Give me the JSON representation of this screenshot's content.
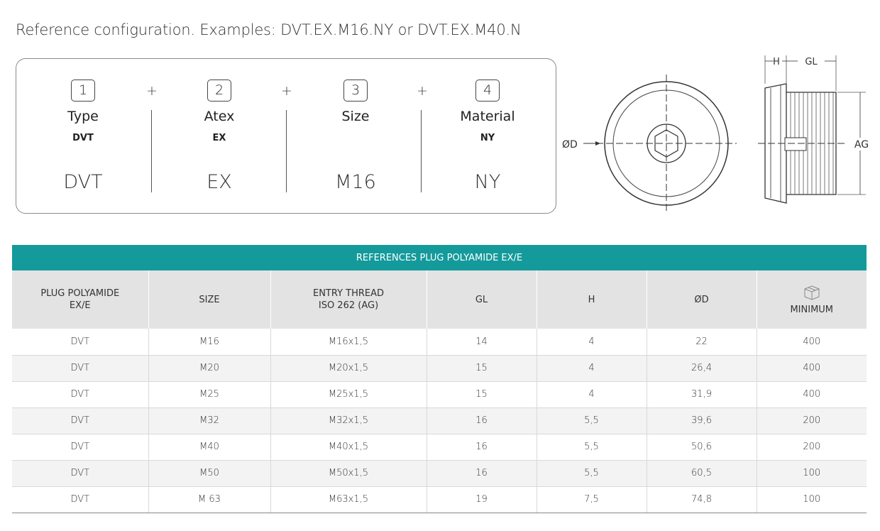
{
  "headline": "Reference configuration. Examples: DVT.EX.M16.NY or DVT.EX.M40.N",
  "configurator": {
    "plus_sign": "+",
    "columns": [
      {
        "number": "1",
        "title": "Type",
        "code": "DVT",
        "value": "DVT"
      },
      {
        "number": "2",
        "title": "Atex",
        "code": "EX",
        "value": "EX"
      },
      {
        "number": "3",
        "title": "Size",
        "code": "",
        "value": "M16"
      },
      {
        "number": "4",
        "title": "Material",
        "code": "NY",
        "value": "NY"
      }
    ]
  },
  "drawing": {
    "label_diameter": "ØD",
    "label_h": "H",
    "label_gl": "GL",
    "label_ag": "AG"
  },
  "table": {
    "title": "REFERENCES PLUG POLYAMIDE EX/E",
    "headers": {
      "product_line1": "PLUG POLYAMIDE",
      "product_line2": "EX/E",
      "size": "SIZE",
      "thread_line1": "ENTRY THREAD",
      "thread_line2": "ISO 262 (AG)",
      "gl": "GL",
      "h": "H",
      "d": "ØD",
      "minimum": "MINIMUM",
      "minimum_icon": "box-icon"
    },
    "rows": [
      [
        "DVT",
        "M16",
        "M16x1,5",
        "14",
        "4",
        "22",
        "400"
      ],
      [
        "DVT",
        "M20",
        "M20x1,5",
        "15",
        "4",
        "26,4",
        "400"
      ],
      [
        "DVT",
        "M25",
        "M25x1,5",
        "15",
        "4",
        "31,9",
        "400"
      ],
      [
        "DVT",
        "M32",
        "M32x1,5",
        "16",
        "5,5",
        "39,6",
        "200"
      ],
      [
        "DVT",
        "M40",
        "M40x1,5",
        "16",
        "5,5",
        "50,6",
        "200"
      ],
      [
        "DVT",
        "M50",
        "M50x1,5",
        "16",
        "5,5",
        "60,5",
        "100"
      ],
      [
        "DVT",
        "M 63",
        "M63x1,5",
        "19",
        "7,5",
        "74,8",
        "100"
      ]
    ]
  }
}
